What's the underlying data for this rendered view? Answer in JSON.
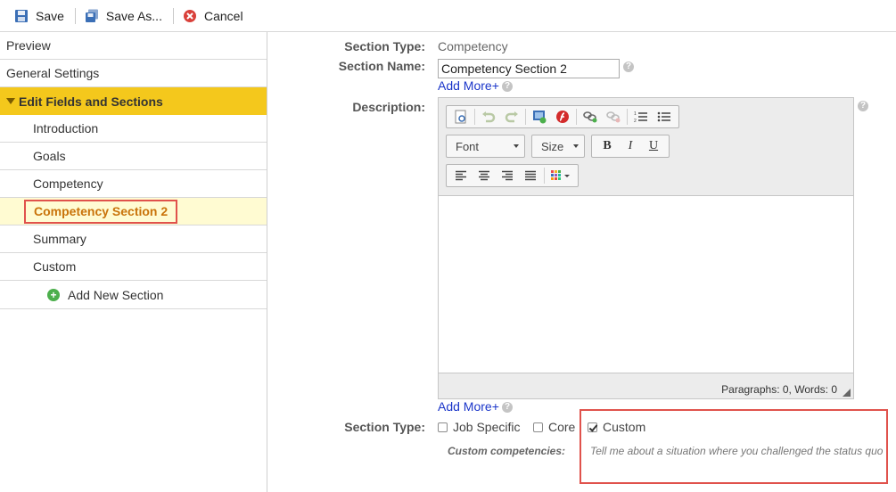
{
  "toolbar": {
    "save": "Save",
    "save_as": "Save As...",
    "cancel": "Cancel"
  },
  "sidebar": {
    "preview": "Preview",
    "general_settings": "General Settings",
    "edit_group": "Edit Fields and Sections",
    "items": [
      "Introduction",
      "Goals",
      "Competency",
      "Competency Section 2",
      "Summary",
      "Custom"
    ],
    "add_new_section": "Add New Section"
  },
  "main": {
    "section_type_label": "Section Type:",
    "section_type_value": "Competency",
    "section_name_label": "Section Name:",
    "section_name_value": "Competency Section 2",
    "add_more": "Add More+",
    "description_label": "Description:",
    "editor": {
      "font": "Font",
      "size": "Size",
      "bold": "B",
      "italic": "I",
      "underline": "U",
      "status": "Paragraphs: 0, Words: 0"
    },
    "add_more_2": "Add More+",
    "section_type2_label": "Section Type:",
    "job_specific": "Job Specific",
    "core": "Core",
    "custom": "Custom",
    "custom_competencies_label": "Custom competencies:",
    "custom_competencies_value": "Tell me about a situation where you challenged the status quo"
  },
  "colors": {
    "active_group": "#f4c81c",
    "selected_bg": "#fffbd2",
    "selected_text": "#c9730a",
    "highlight_border": "#e0524c",
    "link": "#1a35c9"
  }
}
